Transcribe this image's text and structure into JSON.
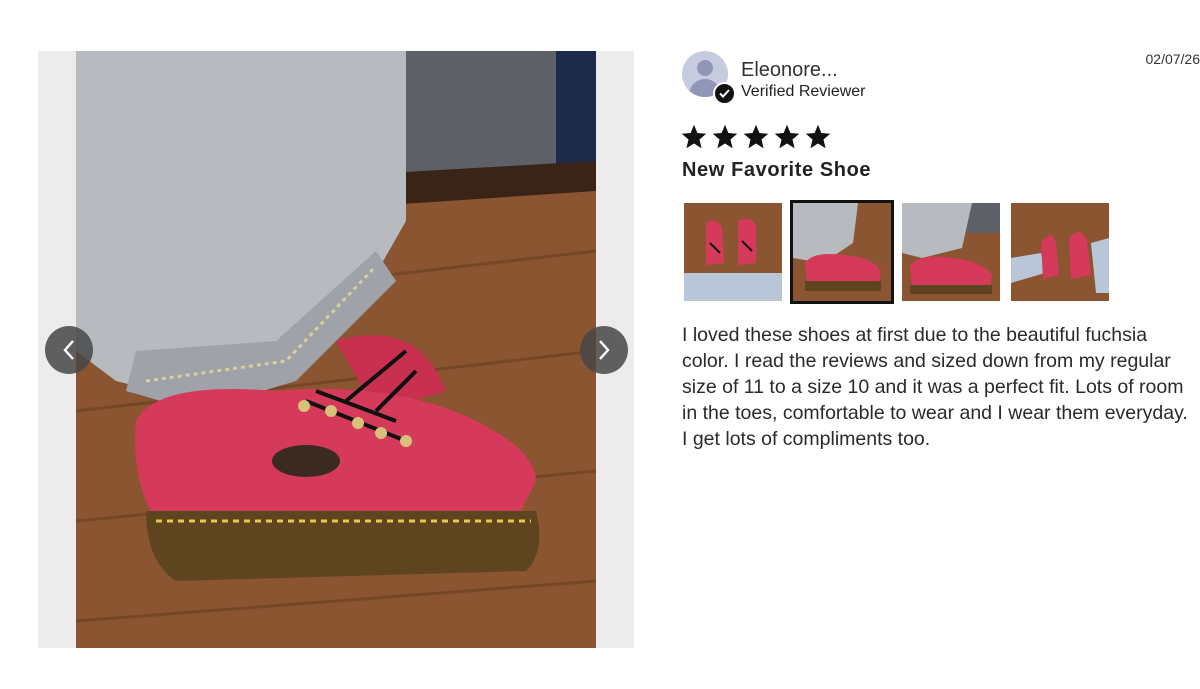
{
  "reviewer": {
    "name": "Eleonore...",
    "verified_label": "Verified Reviewer",
    "date": "02/07/26"
  },
  "rating": {
    "stars": 5,
    "max": 5
  },
  "review": {
    "title": "New Favorite Shoe",
    "body": "I loved these shoes at first due to the beautiful fuchsia color. I read the reviews and sized down from my regular size of 11 to a size 10 and it was a perfect fit. Lots of room in the toes, comfortable to wear and I wear them everyday. I get lots of compliments too."
  },
  "gallery": {
    "prev_icon": "chevron-left-icon",
    "next_icon": "chevron-right-icon",
    "thumbnails_count": 4,
    "active_thumbnail": 2
  },
  "colors": {
    "shoe": "#d63a5a",
    "denim": "#b9bcc0",
    "floor": "#8a5a30",
    "star": "#111111"
  }
}
